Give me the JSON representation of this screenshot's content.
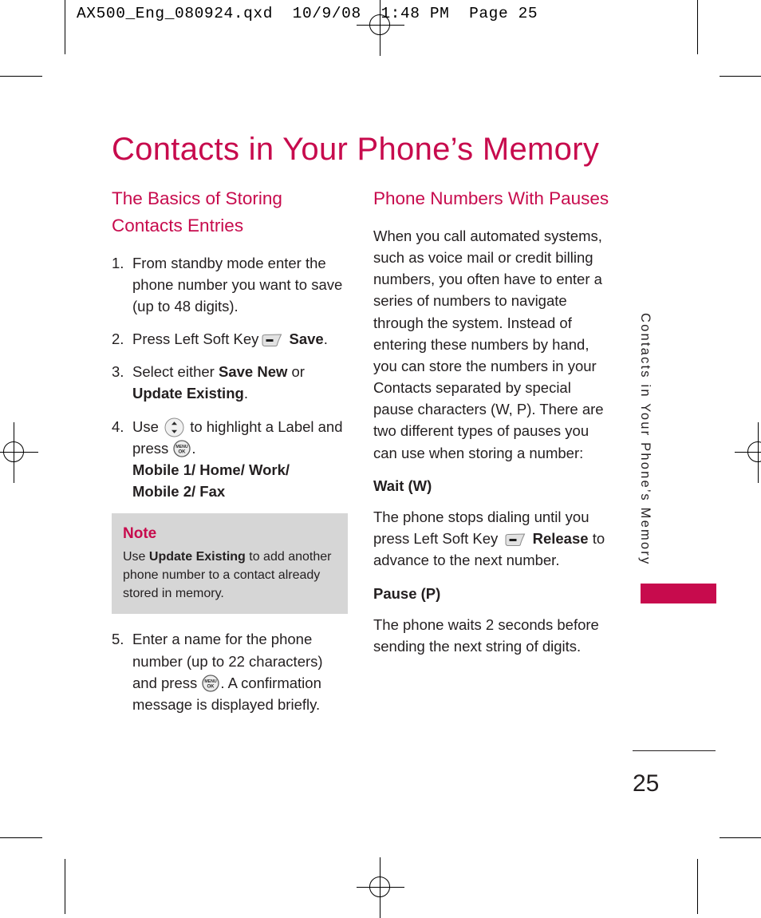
{
  "prepress": {
    "header": "AX500_Eng_080924.qxd  10/9/08  1:48 PM  Page 25"
  },
  "page": {
    "chapter_title": "Contacts in Your Phone’s Memory",
    "running_head": "Contacts in Your Phone’s Memory",
    "folio": "25",
    "accent_color": "#C70B4D",
    "note_bg_color": "#D6D6D6",
    "text_color": "#231F20"
  },
  "left_column": {
    "heading": "The Basics of Storing Contacts Entries",
    "steps": [
      {
        "num": "1.",
        "text": "From standby mode enter the phone number you want to save (up to 48 digits)."
      },
      {
        "num": "2.",
        "text_before": "Press Left Soft Key",
        "icon": "left-soft-key",
        "bold_after": "Save",
        "text_after": "."
      },
      {
        "num": "3.",
        "text_before": "Select either",
        "bold_1": "Save New",
        "text_mid": "or",
        "bold_2": "Update Existing",
        "text_after": "."
      },
      {
        "num": "4.",
        "text_before": "Use",
        "icon_nav": "navigation-key",
        "text_mid": "to highlight a Label and press",
        "icon_ok": "menu-ok-key",
        "text_after": ".",
        "labels_line_1": "Mobile 1/ Home/ Work/",
        "labels_line_2": "Mobile 2/ Fax"
      },
      {
        "num": "5.",
        "text_before": "Enter a name for the phone number (up to 22 characters) and press",
        "icon_ok": "menu-ok-key",
        "text_after": ". A confirmation message is displayed briefly."
      }
    ],
    "note": {
      "title": "Note",
      "text_before": "Use",
      "bold": "Update Existing",
      "text_after": "to add another phone number to a contact already stored in memory."
    }
  },
  "right_column": {
    "heading": "Phone Numbers With Pauses",
    "intro": "When you call automated systems, such as voice mail or credit billing numbers, you often have to enter a series of numbers to navigate through the system. Instead of entering these numbers by hand, you can store the numbers in your Contacts separated by special pause characters (W, P). There are two different types of pauses you can use when storing a number:",
    "sections": [
      {
        "subhead": "Wait (W)",
        "text_before": "The phone stops dialing until you press Left Soft Key",
        "icon": "left-soft-key",
        "bold_after": "Release",
        "text_after": "to advance to the next number."
      },
      {
        "subhead": "Pause (P)",
        "text": "The phone waits 2 seconds before sending the next string of digits."
      }
    ]
  },
  "icons": {
    "left_soft_key": "left-soft-key",
    "navigation_key": "navigation-key",
    "menu_ok_key": "menu-ok-key",
    "menu_ok_label_top": "MENU",
    "menu_ok_label_bottom": "OK",
    "registration_mark": "registration-target-icon",
    "crop_mark": "crop-mark-icon"
  }
}
